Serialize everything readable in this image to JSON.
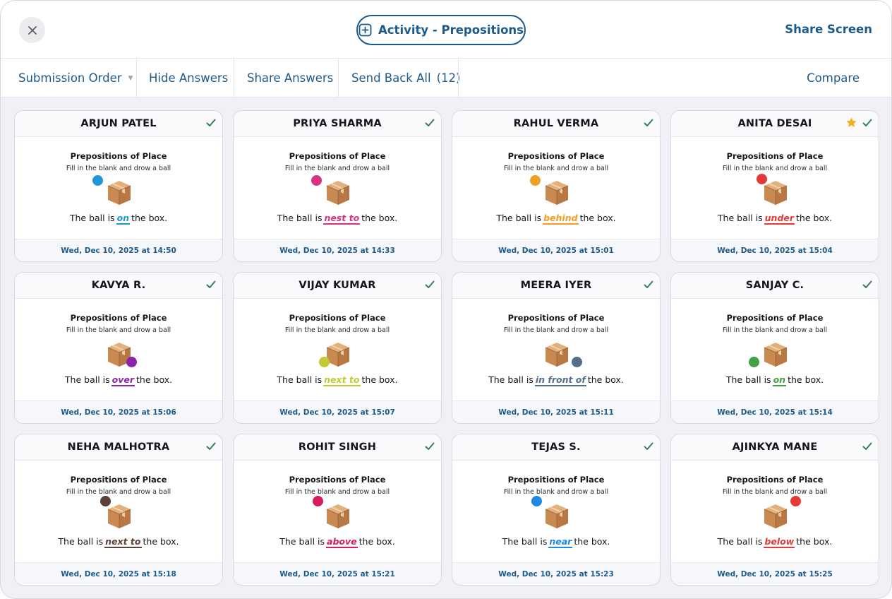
{
  "header": {
    "close_icon": "close-icon",
    "activity_icon": "plus-square-icon",
    "activity_label": "Activity - Prepositions",
    "share_screen_label": "Share Screen",
    "accent_color": "#1d5a8a"
  },
  "toolbar": {
    "submission_order_label": "Submission Order",
    "submission_order_icon": "chevron-down-icon",
    "hide_answers_label": "Hide Answers",
    "share_answers_label": "Share Answers",
    "send_back_all_label": "Send Back All",
    "send_back_count": "(12)",
    "compare_label": "Compare"
  },
  "worksheet": {
    "title": "Prepositions of Place",
    "instruction": "Fill in the blank and drow a ball",
    "sentence_start": "The ball is",
    "sentence_end": "the box.",
    "box_icon": "cardboard-box-icon"
  },
  "submissions": [
    {
      "name": "ARJUN PATEL",
      "answer": "on",
      "color": "#2196d6",
      "timestamp": "Wed, Dec 10, 2025 at 14:50",
      "checked": true,
      "starred": false
    },
    {
      "name": "PRIYA SHARMA",
      "answer": "nest to",
      "color": "#d63384",
      "timestamp": "Wed, Dec 10, 2025 at 14:33",
      "checked": true,
      "starred": false
    },
    {
      "name": "RAHUL VERMA",
      "answer": "behind",
      "color": "#f0a020",
      "timestamp": "Wed, Dec 10, 2025 at 15:01",
      "checked": true,
      "starred": false
    },
    {
      "name": "ANITA DESAI",
      "answer": "under",
      "color": "#e53935",
      "timestamp": "Wed, Dec 10, 2025 at 15:04",
      "checked": true,
      "starred": true
    },
    {
      "name": "KAVYA R.",
      "answer": "over",
      "color": "#8e24aa",
      "timestamp": "Wed, Dec 10, 2025 at 15:06",
      "checked": true,
      "starred": false
    },
    {
      "name": "VIJAY KUMAR",
      "answer": "next to",
      "color": "#c0ca33",
      "timestamp": "Wed, Dec 10, 2025 at 15:07",
      "checked": true,
      "starred": false
    },
    {
      "name": "MEERA IYER",
      "answer": "in front of",
      "color": "#546e8a",
      "timestamp": "Wed, Dec 10, 2025 at 15:11",
      "checked": true,
      "starred": false
    },
    {
      "name": "SANJAY C.",
      "answer": "on",
      "color": "#43a047",
      "timestamp": "Wed, Dec 10, 2025 at 15:14",
      "checked": true,
      "starred": false
    },
    {
      "name": "NEHA MALHOTRA",
      "answer": "next to",
      "color": "#5d4037",
      "timestamp": "Wed, Dec 10, 2025 at 15:18",
      "checked": true,
      "starred": false
    },
    {
      "name": "ROHIT SINGH",
      "answer": "above",
      "color": "#d81b60",
      "timestamp": "Wed, Dec 10, 2025 at 15:21",
      "checked": true,
      "starred": false
    },
    {
      "name": "TEJAS S.",
      "answer": "near",
      "color": "#1e88e5",
      "timestamp": "Wed, Dec 10, 2025 at 15:23",
      "checked": true,
      "starred": false
    },
    {
      "name": "AJINKYA MANE",
      "answer": "below",
      "color": "#e53935",
      "timestamp": "Wed, Dec 10, 2025 at 15:25",
      "checked": true,
      "starred": false
    }
  ],
  "status_colors": {
    "check": "#2e7d4f",
    "star": "#f2b01e"
  }
}
